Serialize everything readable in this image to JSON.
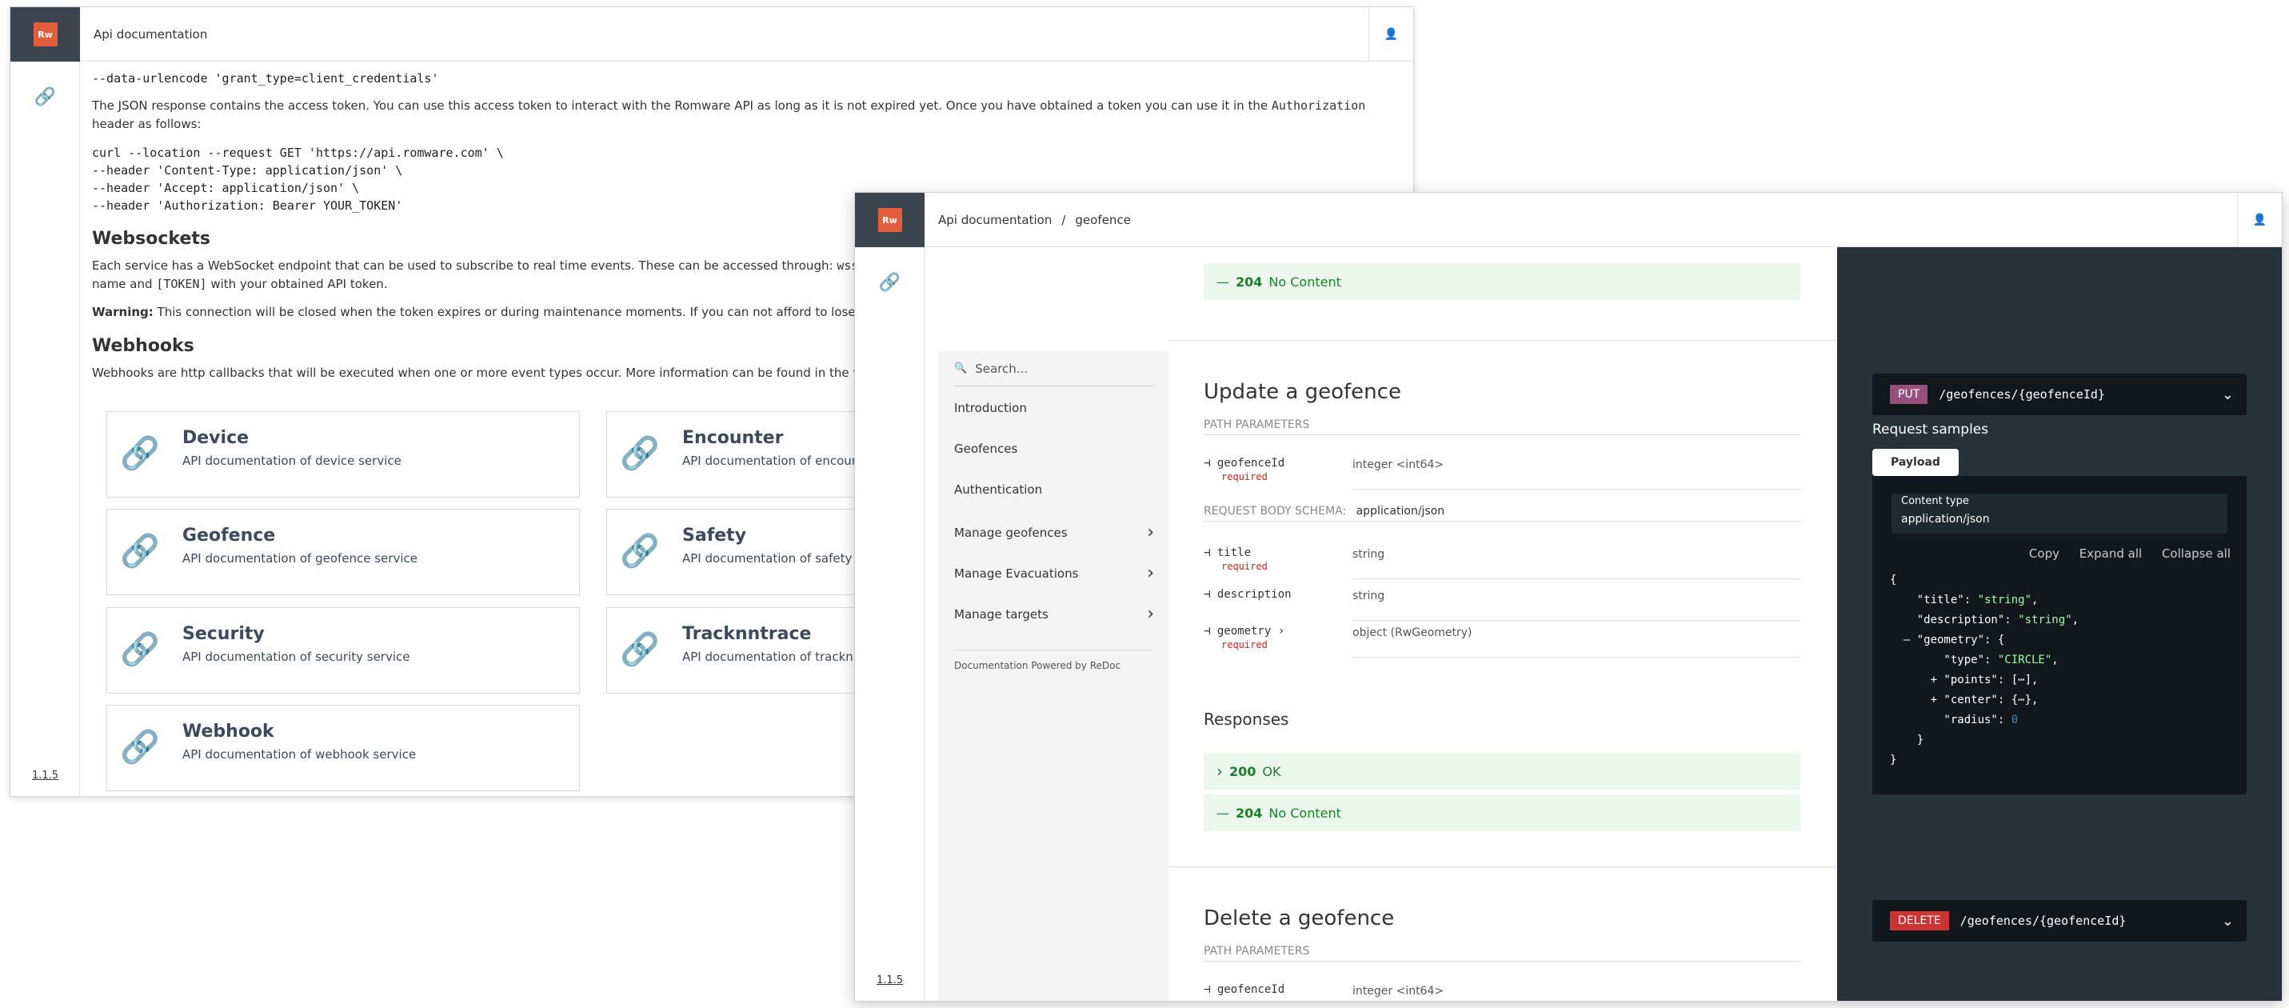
{
  "back_window": {
    "title": "Api documentation",
    "logo_text": "Rw",
    "version": "1.1.5",
    "code_top": "--data-urlencode 'grant_type=client_credentials'",
    "token_text": "The JSON response contains the access token. You can use this access token to interact with the Romware API as long as it is not expired yet. Once you have obtained a token you can use it in the",
    "token_code": "Authorization",
    "token_text_end": "header as follows:",
    "curl_lines": [
      "curl --location --request GET 'https://api.romware.com' \\",
      "--header 'Content-Type: application/json' \\",
      "--header 'Accept: application/json' \\",
      "--header 'Authorization: Bearer YOUR_TOKEN'"
    ],
    "websockets_heading": "Websockets",
    "websockets_text": "Each service has a WebSocket endpoint that can be used to subscribe to real time events. These can be accessed through:",
    "websockets_code": "wss://api.romw",
    "websockets_text2_pre": "name and",
    "websockets_text2_code": "[TOKEN]",
    "websockets_text2_post": "with your obtained API token.",
    "warning_label": "Warning:",
    "warning_text": "This connection will be closed when the token expires or during maintenance moments. If you can not afford to lose events we sugg",
    "webhooks_heading": "Webhooks",
    "webhooks_text": "Webhooks are http callbacks that will be executed when one or more event types occur. More information can be found in the webhook servi",
    "cards": [
      {
        "title": "Device",
        "desc": "API documentation of device service"
      },
      {
        "title": "Encounter",
        "desc": "API documentation of encounter"
      },
      {
        "title": "Geofence",
        "desc": "API documentation of geofence service"
      },
      {
        "title": "Safety",
        "desc": "API documentation of safety ser"
      },
      {
        "title": "Security",
        "desc": "API documentation of security service"
      },
      {
        "title": "Tracknntrace",
        "desc": "API documentation of tracknntrac"
      },
      {
        "title": "Webhook",
        "desc": "API documentation of webhook service"
      }
    ]
  },
  "front_window": {
    "breadcrumb": "Api documentation",
    "breadcrumb_sep": "/",
    "breadcrumb_current": "geofence",
    "logo_text": "Rw",
    "version": "1.1.5",
    "search_placeholder": "Search...",
    "menu": [
      {
        "label": "Introduction",
        "chevron": ""
      },
      {
        "label": "Geofences",
        "chevron": ""
      },
      {
        "label": "Authentication",
        "chevron": ""
      },
      {
        "label": "Manage geofences",
        "chevron": "›"
      },
      {
        "label": "Manage Evacuations",
        "chevron": "›"
      },
      {
        "label": "Manage targets",
        "chevron": "›"
      }
    ],
    "powered_by": "Documentation Powered by ReDoc",
    "top_response": {
      "code": "204",
      "text": "No Content"
    },
    "update": {
      "title": "Update a geofence",
      "path_params_label": "PATH PARAMETERS",
      "params": [
        {
          "name": "geofenceId",
          "required": "required",
          "type": "integer <int64>"
        }
      ],
      "body_label": "REQUEST BODY SCHEMA:",
      "body_type": "application/json",
      "body_params": [
        {
          "name": "title",
          "required": "required",
          "type": "string"
        },
        {
          "name": "description",
          "required": "",
          "type": "string"
        },
        {
          "name": "geometry ›",
          "required": "required",
          "type": "object (RwGeometry)"
        }
      ],
      "responses_label": "Responses",
      "responses": [
        {
          "code": "200",
          "text": "OK",
          "prefix": "›"
        },
        {
          "code": "204",
          "text": "No Content",
          "prefix": "—"
        }
      ]
    },
    "delete": {
      "title": "Delete a geofence",
      "path_params_label": "PATH PARAMETERS",
      "param_name": "geofenceId",
      "param_type": "integer <int64>"
    },
    "right": {
      "put_method": "PUT",
      "put_path": "/geofences/{geofenceId}",
      "request_samples": "Request samples",
      "payload": "Payload",
      "content_type_label": "Content type",
      "content_type_value": "application/json",
      "copy": "Copy",
      "expand_all": "Expand all",
      "collapse_all": "Collapse all",
      "delete_method": "DELETE",
      "delete_path": "/geofences/{geofenceId}"
    },
    "colors": {
      "put": "#95507c",
      "delete": "#cc3333",
      "accent": "#e35e3c",
      "success": "#1d8127"
    }
  }
}
